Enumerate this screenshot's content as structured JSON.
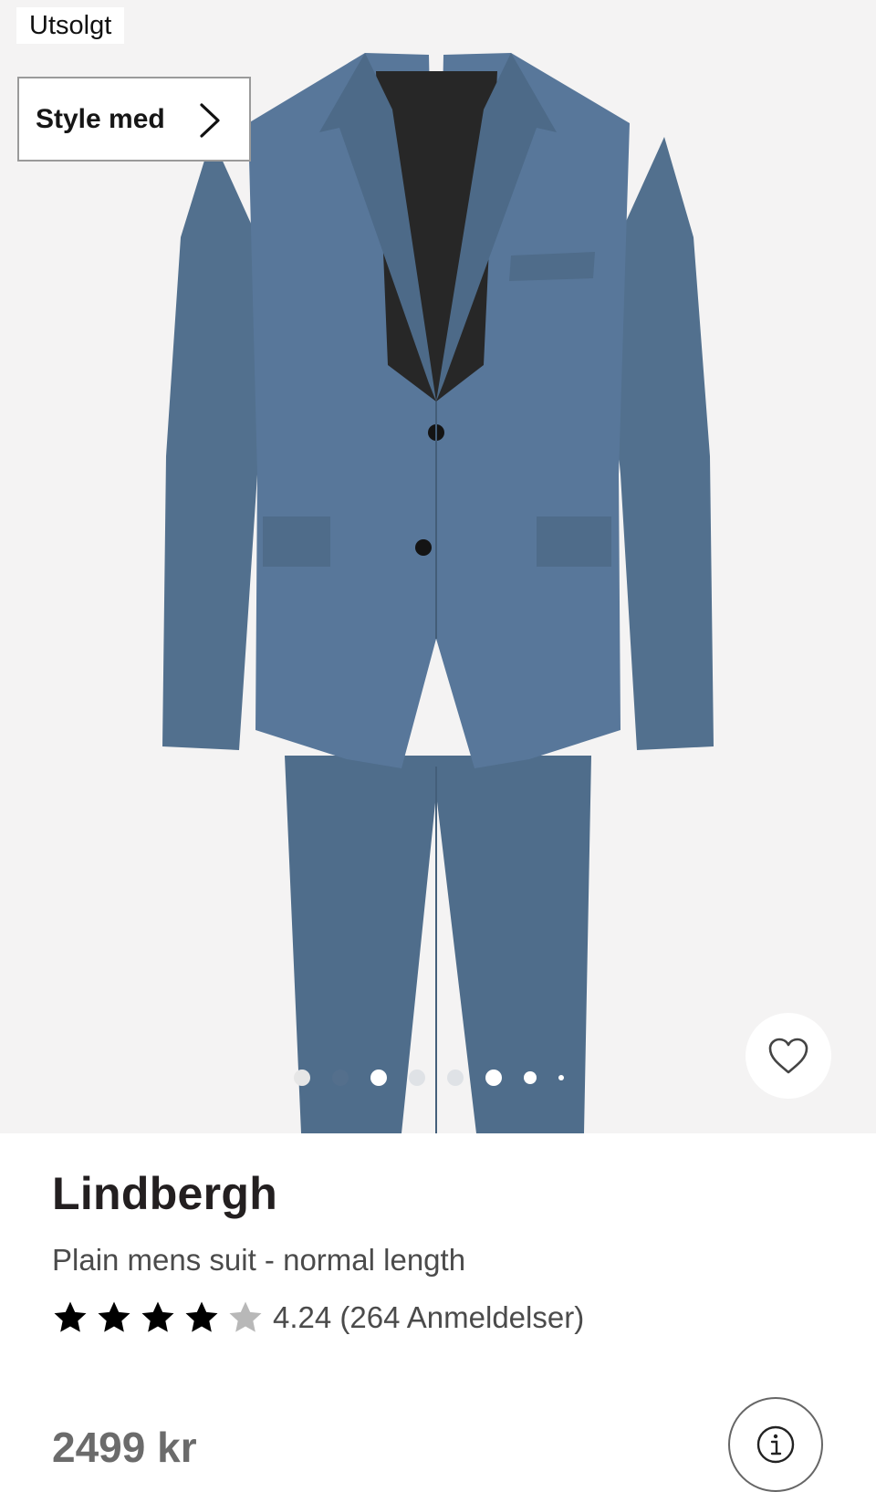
{
  "hero": {
    "badge": "Utsolgt",
    "style_button_label": "Style med",
    "image_alt": "Blue two-piece mens suit",
    "carousel_dot_count": 8,
    "carousel_active_index": 1
  },
  "product": {
    "brand": "Lindbergh",
    "name": "Plain mens suit - normal length",
    "rating_value": 4.24,
    "rating_text": "4.24 (264 Anmeldelser)",
    "stars_filled": 4,
    "stars_total": 5,
    "price": "2499 kr"
  },
  "icons": {
    "style_chevron": "chevron-right-icon",
    "favorite": "heart-icon",
    "info": "info-icon"
  },
  "colors": {
    "suit": "#53718f",
    "hero_bg": "#f4f3f3",
    "star_filled": "#000000",
    "star_empty": "#b8b8b8"
  }
}
